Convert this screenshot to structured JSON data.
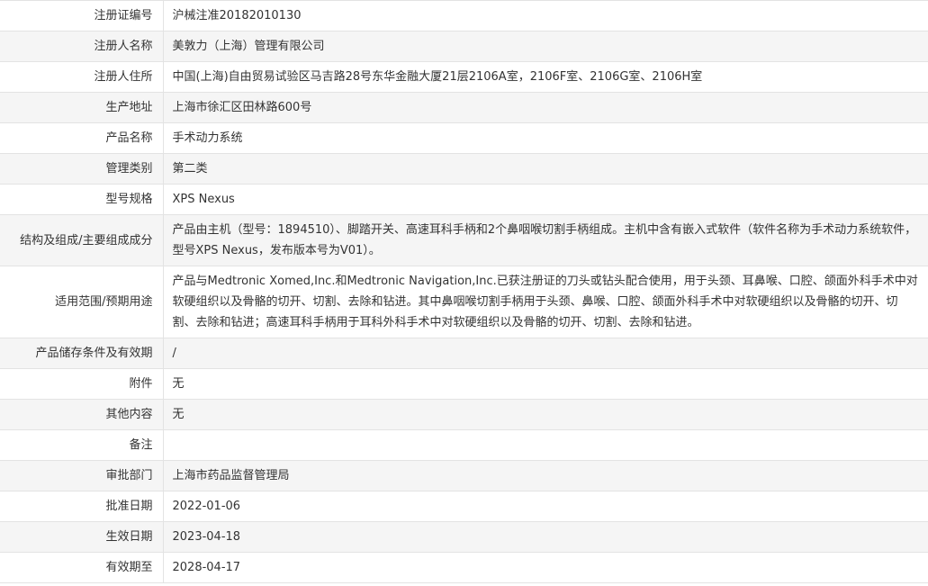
{
  "rows": [
    {
      "label": "注册证编号",
      "value": "沪械注准20182010130"
    },
    {
      "label": "注册人名称",
      "value": "美敦力（上海）管理有限公司"
    },
    {
      "label": "注册人住所",
      "value": "中国(上海)自由贸易试验区马吉路28号东华金融大厦21层2106A室，2106F室、2106G室、2106H室"
    },
    {
      "label": "生产地址",
      "value": "上海市徐汇区田林路600号"
    },
    {
      "label": "产品名称",
      "value": "手术动力系统"
    },
    {
      "label": "管理类别",
      "value": "第二类"
    },
    {
      "label": "型号规格",
      "value": "XPS Nexus"
    },
    {
      "label": "结构及组成/主要组成成分",
      "value": "产品由主机（型号：1894510）、脚踏开关、高速耳科手柄和2个鼻咽喉切割手柄组成。主机中含有嵌入式软件（软件名称为手术动力系统软件，型号XPS Nexus，发布版本号为V01）。"
    },
    {
      "label": "适用范围/预期用途",
      "value": "产品与Medtronic Xomed,Inc.和Medtronic Navigation,Inc.已获注册证的刀头或钻头配合使用，用于头颈、耳鼻喉、口腔、颌面外科手术中对软硬组织以及骨骼的切开、切割、去除和钻进。其中鼻咽喉切割手柄用于头颈、鼻喉、口腔、颌面外科手术中对软硬组织以及骨骼的切开、切割、去除和钻进；高速耳科手柄用于耳科外科手术中对软硬组织以及骨骼的切开、切割、去除和钻进。"
    },
    {
      "label": "产品储存条件及有效期",
      "value": "/"
    },
    {
      "label": "附件",
      "value": "无"
    },
    {
      "label": "其他内容",
      "value": "无"
    },
    {
      "label": "备注",
      "value": ""
    },
    {
      "label": "审批部门",
      "value": "上海市药品监督管理局"
    },
    {
      "label": "批准日期",
      "value": "2022-01-06"
    },
    {
      "label": "生效日期",
      "value": "2023-04-18"
    },
    {
      "label": "有效期至",
      "value": "2028-04-17"
    }
  ]
}
